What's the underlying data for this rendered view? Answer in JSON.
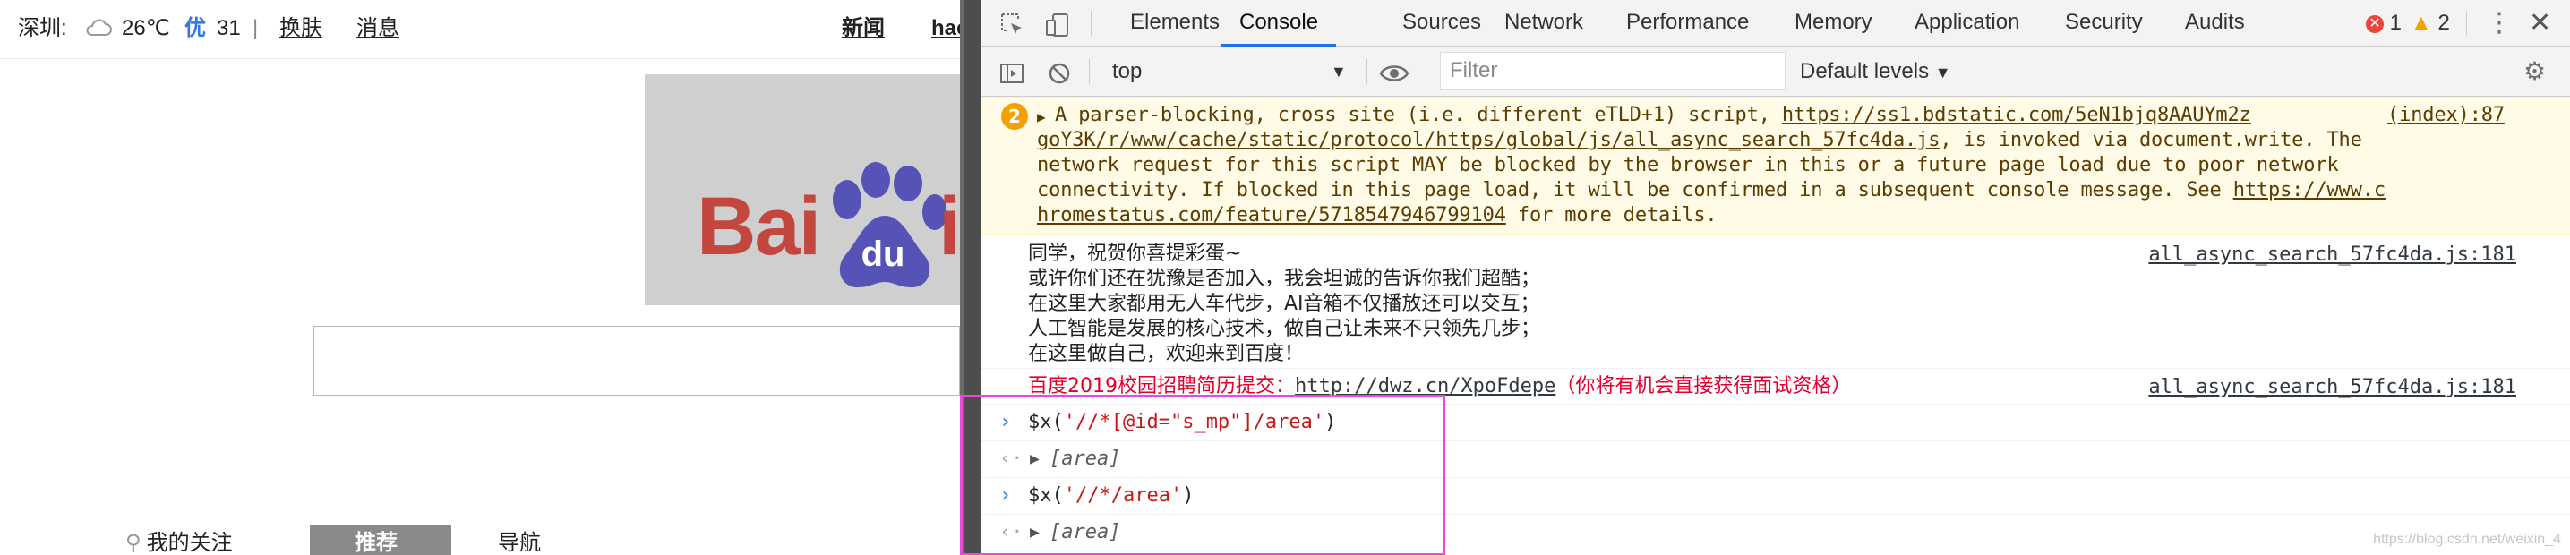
{
  "page": {
    "city": "深圳:",
    "temp": "26℃",
    "aq_label": "优",
    "aq_value": "31",
    "sep": "|",
    "skin": "换肤",
    "messages": "消息",
    "nav_news": "新闻",
    "nav_hao": "hao",
    "logo_text": "Bai",
    "logo_du": "du",
    "tabs": [
      "我的关注",
      "推荐",
      "导航"
    ]
  },
  "devtools": {
    "tabs": [
      "Elements",
      "Console",
      "Sources",
      "Network",
      "Performance",
      "Memory",
      "Application",
      "Security",
      "Audits"
    ],
    "error_count": "1",
    "warning_count": "2",
    "context": "top",
    "filter_placeholder": "Filter",
    "levels": "Default levels",
    "warning": {
      "count": "2",
      "line1_pre": "A parser-blocking, cross site (i.e. different eTLD+1) script, ",
      "line1_link": "https://ss1.bdstatic.com/5eN1bjq8AAUYm2z",
      "line1_src": "(index):87",
      "line2_link": "goY3K/r/www/cache/static/protocol/https/global/js/all_async_search_57fc4da.js",
      "line2_post": ", is invoked via document.write. The",
      "line3": "network request for this script MAY be blocked by the browser in this or a future page load due to poor network",
      "line4_pre": "connectivity. If blocked in this page load, it will be confirmed in a subsequent console message. See ",
      "line4_link": "https://www.c",
      "line5_link": "hromestatus.com/feature/5718547946799104",
      "line5_post": " for more details."
    },
    "log1": {
      "lines": [
        "同学，祝贺你喜提彩蛋~",
        "或许你们还在犹豫是否加入，我会坦诚的告诉你我们超酷；",
        "在这里大家都用无人车代步，AI音箱不仅播放还可以交互；",
        "人工智能是发展的核心技术，做自己让未来不只领先几步；",
        "在这里做自己，欢迎来到百度！"
      ],
      "source": "all_async_search_57fc4da.js:181"
    },
    "log2": {
      "pre": "百度2019校园招聘简历提交：",
      "link": "http://dwz.cn/XpoFdepe",
      "post": "（你将有机会直接获得面试资格）",
      "source": "all_async_search_57fc4da.js:181"
    },
    "cmd1": {
      "prefix": "$x(",
      "str": "'//*[@id=\"s_mp\"]/area'",
      "suffix": ")"
    },
    "res1": "[area]",
    "cmd2": {
      "prefix": "$x(",
      "str": "'//*/area'",
      "suffix": ")"
    },
    "res2": "[area]"
  },
  "watermark": "https://blog.csdn.net/weixin_4",
  "colors": {
    "accent": "#1a73e8",
    "highlight": "#e94ad9",
    "warning_bg": "#fffbe6"
  }
}
